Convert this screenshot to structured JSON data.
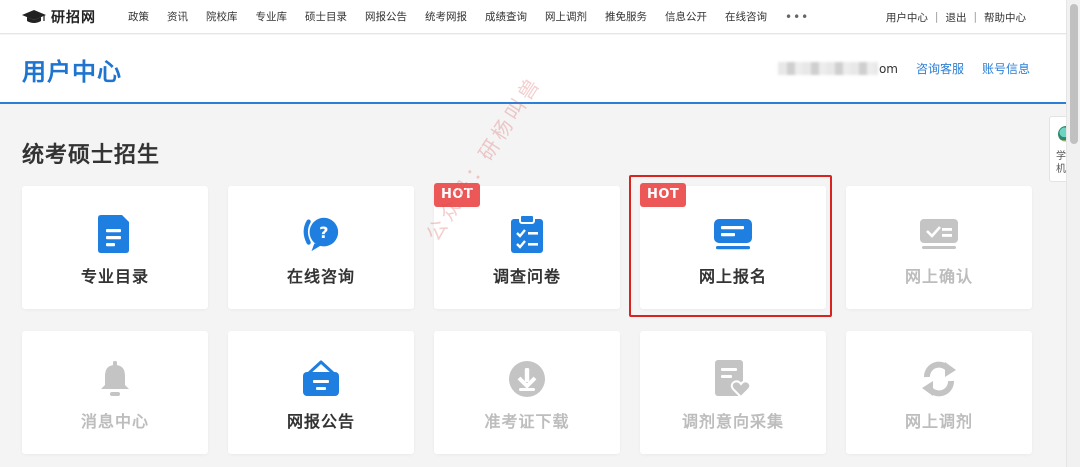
{
  "topbar": {
    "logo_text": "研招网",
    "nav": [
      "政策",
      "资讯",
      "院校库",
      "专业库",
      "硕士目录",
      "网报公告",
      "统考网报",
      "成绩查询",
      "网上调剂",
      "推免服务",
      "信息公开",
      "在线咨询"
    ],
    "more": "•••",
    "user_center": "用户中心",
    "logout": "退出",
    "help": "帮助中心",
    "separator": "|"
  },
  "header": {
    "title": "用户中心",
    "username_suffix": "om",
    "consult": "咨询客服",
    "account": "账号信息"
  },
  "section": {
    "title": "统考硕士招生"
  },
  "cards": [
    {
      "label": "专业目录",
      "icon": "document-icon",
      "enabled": true,
      "hot": ""
    },
    {
      "label": "在线咨询",
      "icon": "question-chat-icon",
      "enabled": true,
      "hot": ""
    },
    {
      "label": "调查问卷",
      "icon": "clipboard-check-icon",
      "enabled": true,
      "hot": "HOT"
    },
    {
      "label": "网上报名",
      "icon": "registration-form-icon",
      "enabled": true,
      "hot": "HOT",
      "highlighted": true
    },
    {
      "label": "网上确认",
      "icon": "confirm-check-icon",
      "enabled": false,
      "hot": ""
    },
    {
      "label": "消息中心",
      "icon": "bell-icon",
      "enabled": false,
      "hot": ""
    },
    {
      "label": "网报公告",
      "icon": "notice-board-icon",
      "enabled": true,
      "hot": ""
    },
    {
      "label": "准考证下载",
      "icon": "download-icon",
      "enabled": false,
      "hot": ""
    },
    {
      "label": "调剂意向采集",
      "icon": "document-heart-icon",
      "enabled": false,
      "hot": ""
    },
    {
      "label": "网上调剂",
      "icon": "refresh-icon",
      "enabled": false,
      "hot": ""
    }
  ],
  "float_widget": {
    "text": "学机"
  },
  "watermark": "公众号：研杨叫兽",
  "colors": {
    "brand_blue": "#1e74cf",
    "icon_blue": "#1f7fe0",
    "disabled_gray": "#bdbdbd",
    "hot_red": "#ec5858",
    "highlight_red": "#d9231e"
  }
}
